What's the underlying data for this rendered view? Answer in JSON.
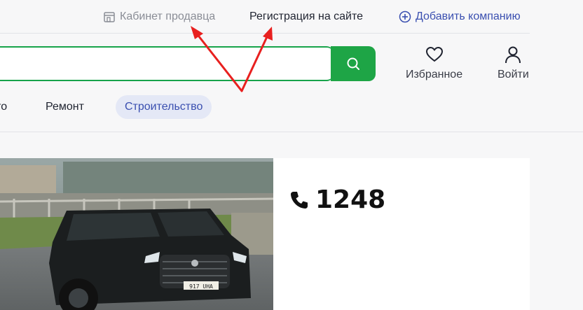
{
  "header": {
    "seller_cabinet": "Кабинет продавца",
    "register": "Регистрация на сайте",
    "add_company": "Добавить компанию"
  },
  "search": {
    "placeholder": ""
  },
  "actions": {
    "favorites": "Избранное",
    "login": "Войти"
  },
  "categories": [
    {
      "label": "вто",
      "active": false
    },
    {
      "label": "Ремонт",
      "active": false
    },
    {
      "label": "Строительство",
      "active": true
    }
  ],
  "banner": {
    "phone": "1248",
    "plate": "917 UHA"
  },
  "colors": {
    "accent_green": "#1ea546",
    "link_blue": "#3a4fb0",
    "active_chip_bg": "#e4e8f6",
    "annotation_red": "#e8201f"
  }
}
